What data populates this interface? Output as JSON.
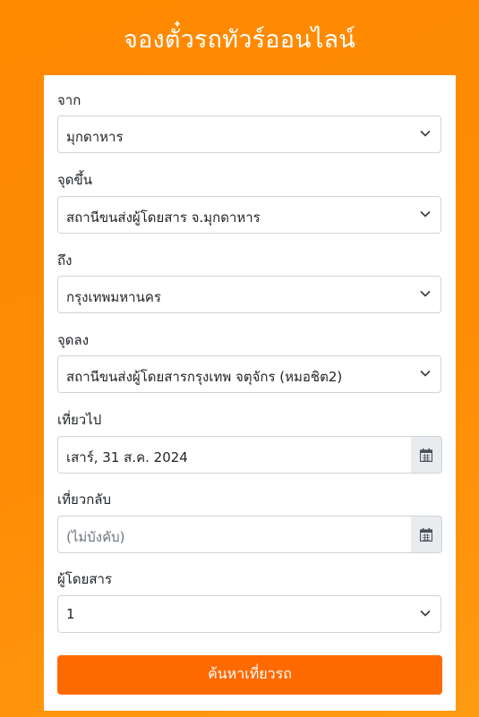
{
  "header": {
    "title": "จองตั๋วรถทัวร์ออนไลน์"
  },
  "form": {
    "from": {
      "label": "จาก",
      "value": "มุกดาหาร"
    },
    "pickup": {
      "label": "จุดขึ้น",
      "value": "สถานีขนส่งผู้โดยสาร จ.มุกดาหาร"
    },
    "to": {
      "label": "ถึง",
      "value": "กรุงเทพมหานคร"
    },
    "dropoff": {
      "label": "จุดลง",
      "value": "สถานีขนส่งผู้โดยสารกรุงเทพ จตุจักร (หมอชิต2)"
    },
    "depart": {
      "label": "เที่ยวไป",
      "value": "เสาร์, 31 ส.ค. 2024"
    },
    "return": {
      "label": "เที่ยวกลับ",
      "placeholder": "(ไม่บังคับ)"
    },
    "passengers": {
      "label": "ผู้โดยสาร",
      "value": "1"
    },
    "search_label": "ค้นหาเที่ยวรถ"
  },
  "icons": {
    "select": "chevron-down-icon",
    "date": "calendar-icon"
  },
  "colors": {
    "background": "#ff8a00",
    "button": "#ff6a00",
    "card": "#ffffff"
  }
}
